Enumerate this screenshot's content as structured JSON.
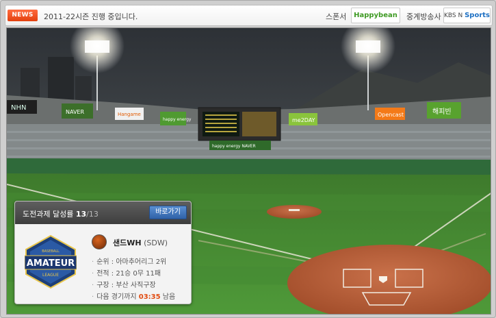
{
  "topbar": {
    "news_badge": "NEWS",
    "news_text": "2011-22시즌 진행 중입니다.",
    "sponsor_label": "스폰서",
    "sponsor_logo": "Happybean",
    "broadcast_label": "중계방송사",
    "broadcast_logo_prefix": "KBS N",
    "broadcast_logo_name": "Sports"
  },
  "signage": {
    "left_board": "NAVER",
    "hangame": "Hangame",
    "happy": "happy energy",
    "me2day": "me2DAY",
    "opencast": "Opencast",
    "happybean_board": "해피빈",
    "nhn": "NHN",
    "scoreboard_strip": "happy energy NAVER"
  },
  "card": {
    "title_prefix": "도전과제 달성률",
    "achieved": "13",
    "total": "/13",
    "go_button": "바로가기",
    "logo_text": "AMATEUR",
    "logo_top": "BASEBALL",
    "logo_bottom": "LEAGUE",
    "team_name": "샌드WH",
    "team_code": "(SDW)",
    "stats": [
      {
        "label": "순위 : 아마추어리그 2위"
      },
      {
        "label": "전적 : 21승 0무 11패"
      },
      {
        "label": "구장 : 부산 사직구장"
      }
    ],
    "next_prefix": "다음 경기까지",
    "next_time": "03:35",
    "next_suffix": "남음"
  },
  "colors": {
    "accent_orange": "#e14b10",
    "button_blue": "#2f62a8",
    "grass": "#3f8a2e",
    "dirt": "#b85d36"
  }
}
